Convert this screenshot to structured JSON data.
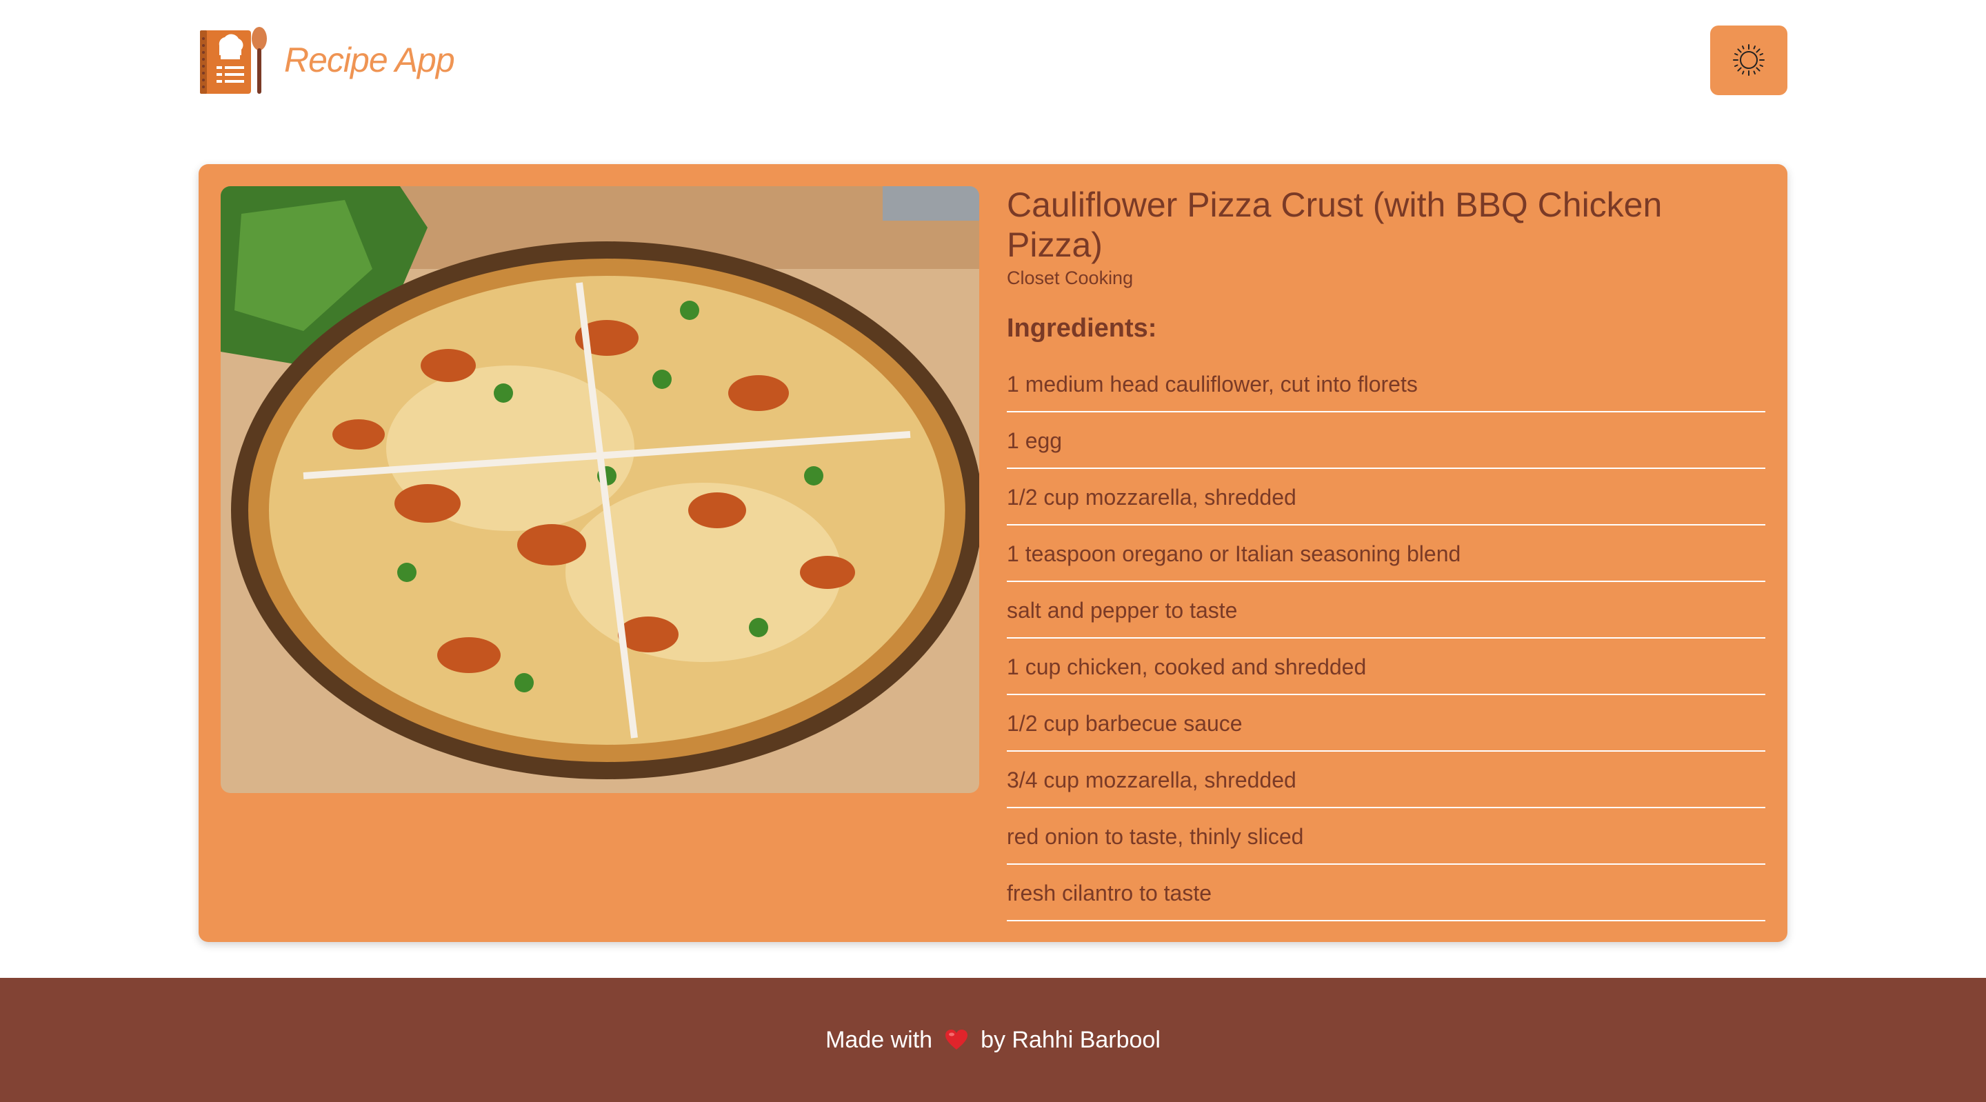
{
  "header": {
    "app_title": "Recipe App",
    "logo_icon": "recipe-book-spoon-icon",
    "theme_toggle_icon": "sun-icon"
  },
  "recipe": {
    "title": "Cauliflower Pizza Crust (with BBQ Chicken Pizza)",
    "source": "Closet Cooking",
    "ingredients_heading": "Ingredients:",
    "ingredients": [
      "1 medium head cauliflower, cut into florets",
      "1 egg",
      "1/2 cup mozzarella, shredded",
      "1 teaspoon oregano or Italian seasoning blend",
      "salt and pepper to taste",
      "1 cup chicken, cooked and shredded",
      "1/2 cup barbecue sauce",
      "3/4 cup mozzarella, shredded",
      "red onion to taste, thinly sliced",
      "fresh cilantro to taste"
    ]
  },
  "footer": {
    "made_with": "Made with",
    "heart_icon": "heart-icon",
    "by_author": "by Rahhi Barbool"
  },
  "colors": {
    "accent": "#ef9453",
    "text_dark": "#7a3a26",
    "footer_bg": "#824334"
  }
}
